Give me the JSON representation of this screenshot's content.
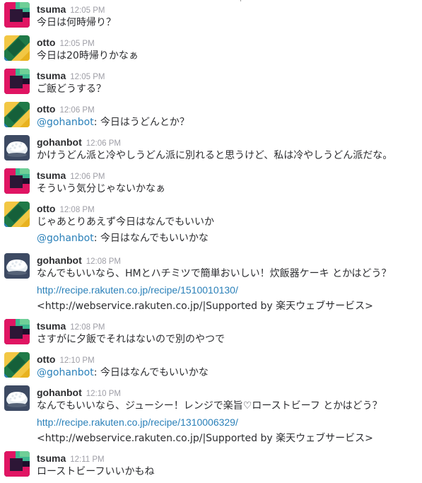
{
  "messages": [
    {
      "user": "tsuma",
      "time": "12:05 PM",
      "avatar": "tsuma-avatar",
      "lines": [
        {
          "text": "今日は何時帰り？"
        }
      ]
    },
    {
      "user": "otto",
      "time": "12:05 PM",
      "avatar": "otto-avatar",
      "lines": [
        {
          "text": "今日は20時帰りかなぁ"
        }
      ]
    },
    {
      "user": "tsuma",
      "time": "12:05 PM",
      "avatar": "tsuma-avatar",
      "lines": [
        {
          "text": "ご飯どうする？"
        }
      ]
    },
    {
      "user": "otto",
      "time": "12:06 PM",
      "avatar": "otto-avatar",
      "lines": [
        {
          "mention": "@gohanbot",
          "text": ": 今日はうどんとか？"
        }
      ]
    },
    {
      "user": "gohanbot",
      "time": "12:06 PM",
      "avatar": "gohanbot-avatar",
      "lines": [
        {
          "text": "かけうどん派と冷やしうどん派に別れると思うけど、私は冷やしうどん派だな。"
        }
      ]
    },
    {
      "user": "tsuma",
      "time": "12:06 PM",
      "avatar": "tsuma-avatar",
      "lines": [
        {
          "text": "そういう気分じゃないかなぁ"
        }
      ]
    },
    {
      "user": "otto",
      "time": "12:08 PM",
      "avatar": "otto-avatar",
      "lines": [
        {
          "text": "じゃあとりあえず今日はなんでもいいか"
        },
        {
          "mention": "@gohanbot",
          "text": ": 今日はなんでもいいかな"
        }
      ]
    },
    {
      "user": "gohanbot",
      "time": "12:08 PM",
      "avatar": "gohanbot-avatar",
      "lines": [
        {
          "text": "なんでもいいなら、HMとハチミツで簡単おいしい！炊飯器ケーキ とかはどう？"
        },
        {
          "link": "http://recipe.rakuten.co.jp/recipe/1510010130/"
        },
        {
          "text": "<http://webservice.rakuten.co.jp/|Supported by 楽天ウェブサービス>"
        }
      ]
    },
    {
      "user": "tsuma",
      "time": "12:08 PM",
      "avatar": "tsuma-avatar",
      "lines": [
        {
          "text": "さすがに夕飯でそれはないので別のやつで"
        }
      ]
    },
    {
      "user": "otto",
      "time": "12:10 PM",
      "avatar": "otto-avatar",
      "lines": [
        {
          "mention": "@gohanbot",
          "text": ": 今日はなんでもいいかな"
        }
      ]
    },
    {
      "user": "gohanbot",
      "time": "12:10 PM",
      "avatar": "gohanbot-avatar",
      "lines": [
        {
          "text": "なんでもいいなら、ジューシー！レンジで楽旨♡ローストビーフ とかはどう？"
        },
        {
          "link": "http://recipe.rakuten.co.jp/recipe/1310006329/"
        },
        {
          "text": "<http://webservice.rakuten.co.jp/|Supported by 楽天ウェブサービス>"
        }
      ]
    },
    {
      "user": "tsuma",
      "time": "12:11 PM",
      "avatar": "tsuma-avatar",
      "lines": [
        {
          "text": "ローストビーフいいかもね"
        }
      ]
    }
  ]
}
